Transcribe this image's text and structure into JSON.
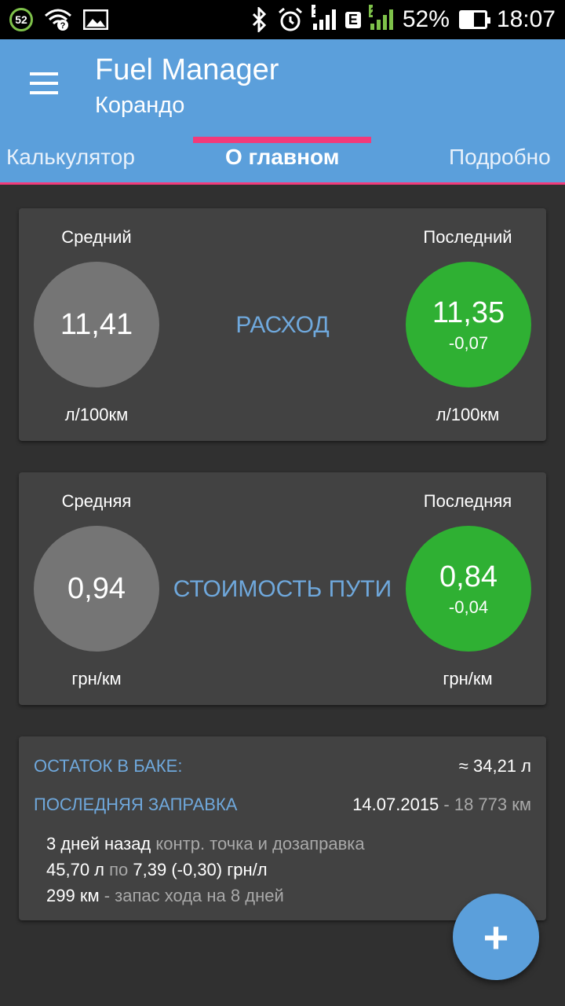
{
  "status_bar": {
    "badge": "52",
    "sim1": "1",
    "network_type": "E",
    "sim2": "2",
    "battery_percent": "52%",
    "battery_level": 0.52,
    "time": "18:07"
  },
  "app_bar": {
    "title": "Fuel Manager",
    "subtitle": "Корандо",
    "tabs": [
      {
        "label": "Калькулятор"
      },
      {
        "label": "О главном"
      },
      {
        "label": "Подробно"
      }
    ],
    "active_tab": 1
  },
  "consumption": {
    "avg_label": "Средний",
    "last_label": "Последний",
    "avg_value": "11,41",
    "last_value": "11,35",
    "last_delta": "-0,07",
    "title": "РАСХОД",
    "unit_left": "л/100км",
    "unit_right": "л/100км"
  },
  "trip_cost": {
    "avg_label": "Средняя",
    "last_label": "Последняя",
    "avg_value": "0,94",
    "last_value": "0,84",
    "last_delta": "-0,04",
    "title": "СТОИМОСТЬ ПУТИ",
    "unit_left": "грн/км",
    "unit_right": "грн/км"
  },
  "tank": {
    "remaining_label": "ОСТАТОК В БАКЕ:",
    "remaining_value": "≈ 34,21 л",
    "last_fill_label": "ПОСЛЕДНЯЯ ЗАПРАВКА",
    "last_fill_date": "14.07.2015",
    "last_fill_odometer": " - 18 773 км",
    "line1_main": "3 дней назад",
    "line1_muted": " контр. точка и дозаправка",
    "line2_volume": "45,70 л",
    "line2_muted": " по ",
    "line2_price": "7,39 (-0,30) грн/л",
    "line3_range": "299 км",
    "line3_muted": " - запас хода на 8 дней"
  },
  "fab": {
    "label": "+"
  }
}
